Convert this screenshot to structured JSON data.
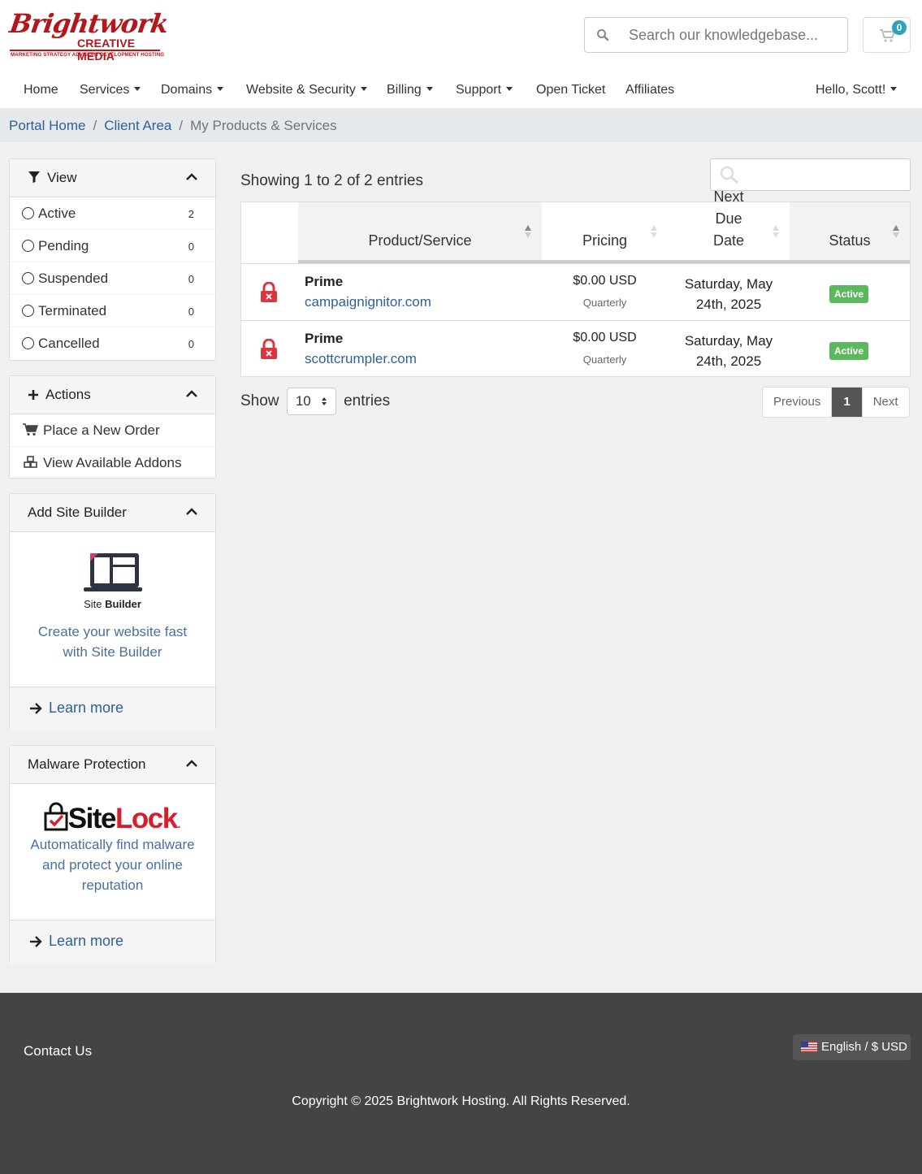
{
  "brand": {
    "script": "Brightwork",
    "subtitle": "CREATIVE MEDIA",
    "tagline": "MARKETING STRATEGY ADVISORY DEVELOPMENT HOSTING"
  },
  "header": {
    "search_placeholder": "Search our knowledgebase...",
    "cart_count": "0"
  },
  "nav": {
    "home": "Home",
    "services": "Services",
    "domains": "Domains",
    "website_security": "Website & Security",
    "billing": "Billing",
    "support": "Support",
    "open_ticket": "Open Ticket",
    "affiliates": "Affiliates",
    "user": "Hello, Scott!"
  },
  "breadcrumb": {
    "items": [
      "Portal Home",
      "Client Area"
    ],
    "current": "My Products & Services",
    "separator": "/"
  },
  "sidebar": {
    "view": {
      "title": "View",
      "filters": [
        {
          "label": "Active",
          "count": "2"
        },
        {
          "label": "Pending",
          "count": "0"
        },
        {
          "label": "Suspended",
          "count": "0"
        },
        {
          "label": "Terminated",
          "count": "0"
        },
        {
          "label": "Cancelled",
          "count": "0"
        }
      ]
    },
    "actions": {
      "title": "Actions",
      "items": [
        "Place a New Order",
        "View Available Addons"
      ]
    },
    "site_builder": {
      "title": "Add Site Builder",
      "logo_text_a": "Site ",
      "logo_text_b": "Builder",
      "text": "Create your website fast with Site Builder",
      "link": "Learn more"
    },
    "malware": {
      "title": "Malware Protection",
      "logo_text_a": "Site",
      "logo_text_b": "Lock",
      "logo_reg": ".",
      "text": "Automatically find malware and protect your online reputation",
      "link": "Learn more"
    }
  },
  "main": {
    "showing": "Showing 1 to 2 of 2 entries",
    "columns": [
      "Product/Service",
      "Pricing",
      "Next Due Date",
      "Status"
    ],
    "rows": [
      {
        "product": "Prime",
        "domain": "campaignignitor.com",
        "price": "$0.00 USD",
        "cycle": "Quarterly",
        "due": "Saturday, May 24th, 2025",
        "status": "Active"
      },
      {
        "product": "Prime",
        "domain": "scottcrumpler.com",
        "price": "$0.00 USD",
        "cycle": "Quarterly",
        "due": "Saturday, May 24th, 2025",
        "status": "Active"
      }
    ],
    "show_label": "Show",
    "page_size": "10",
    "entries_label": "entries",
    "pagination": {
      "previous": "Previous",
      "current": "1",
      "next": "Next"
    }
  },
  "footer": {
    "contact": "Contact Us",
    "language": "English / $ USD",
    "copyright": "Copyright © 2025 Brightwork Hosting. All Rights Reserved."
  },
  "colors": {
    "brand_red": "#b3161b",
    "link_blue": "#2f6196",
    "active_green": "#5cb85c",
    "cart_badge": "#2ba3bb",
    "footer_bg": "#444444"
  },
  "icons": [
    "search-icon",
    "cart-icon",
    "filter-icon",
    "plus-icon",
    "chevron-up-icon",
    "shopping-cart-icon",
    "cubes-icon",
    "arrow-right-icon",
    "lock-icon",
    "sort-icon",
    "us-flag-icon"
  ]
}
